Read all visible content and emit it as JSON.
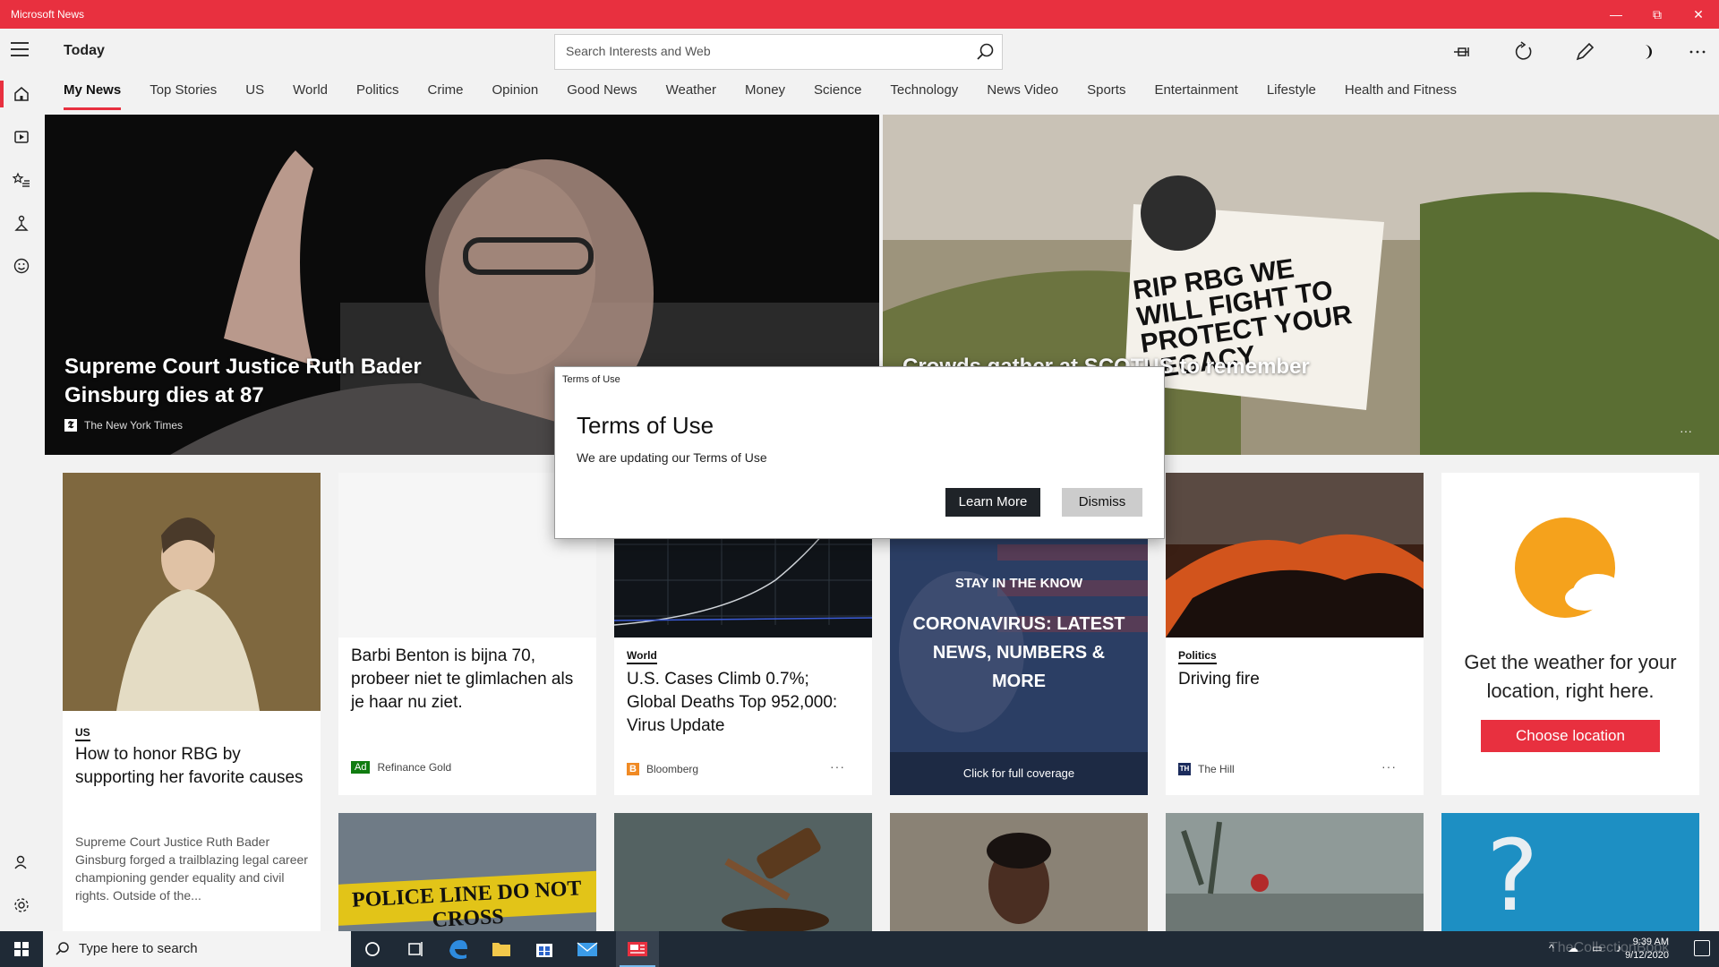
{
  "window": {
    "title": "Microsoft News"
  },
  "header": {
    "title": "Today",
    "search_placeholder": "Search Interests and Web"
  },
  "tabs": [
    {
      "label": "My News",
      "active": true
    },
    {
      "label": "Top Stories"
    },
    {
      "label": "US"
    },
    {
      "label": "World"
    },
    {
      "label": "Politics"
    },
    {
      "label": "Crime"
    },
    {
      "label": "Opinion"
    },
    {
      "label": "Good News"
    },
    {
      "label": "Weather"
    },
    {
      "label": "Money"
    },
    {
      "label": "Science"
    },
    {
      "label": "Technology"
    },
    {
      "label": "News Video"
    },
    {
      "label": "Sports"
    },
    {
      "label": "Entertainment"
    },
    {
      "label": "Lifestyle"
    },
    {
      "label": "Health and Fitness"
    }
  ],
  "hero": {
    "left": {
      "title": "Supreme Court Justice Ruth Bader Ginsburg dies at 87",
      "source": "The New York Times",
      "source_logo": "𝕿"
    },
    "right": {
      "title": "Crowds gather at SCOTUS to remember",
      "image_text": "RIP RBG WE WILL FIGHT TO PROTECT YOUR LEGACY"
    }
  },
  "cards": {
    "rbg": {
      "category": "US",
      "headline": "How to honor RBG by supporting her favorite causes",
      "abstract": "Supreme Court Justice Ruth Bader Ginsburg forged a trailblazing legal career championing gender equality and civil rights. Outside of the..."
    },
    "ad": {
      "headline": "Barbi Benton is bijna 70, probeer niet te glimlachen als je haar nu ziet.",
      "badge": "Ad",
      "source": "Refinance Gold"
    },
    "covid": {
      "category": "World",
      "headline": "U.S. Cases Climb 0.7%; Global Deaths Top 952,000: Virus Update",
      "source": "Bloomberg",
      "source_logo": "B",
      "more": "···"
    },
    "stay": {
      "kicker": "STAY IN THE KNOW",
      "headline": "CORONAVIRUS: LATEST NEWS, NUMBERS & MORE",
      "footer": "Click for full coverage"
    },
    "fire": {
      "category": "Politics",
      "headline": "Driving fire",
      "source": "The Hill",
      "source_logo": "TH",
      "more": "···"
    },
    "weather": {
      "text": "Get the weather for your location, right here.",
      "button": "Choose location"
    },
    "police": {
      "image_text": "POLICE LINE DO NOT CROSS"
    }
  },
  "dialog": {
    "window_title": "Terms of Use",
    "title": "Terms of Use",
    "body": "We are updating our Terms of Use",
    "primary": "Learn More",
    "secondary": "Dismiss"
  },
  "taskbar": {
    "search_placeholder": "Type here to search",
    "time": "9:39 AM",
    "date": "9/12/2020",
    "watermark": "TheCollectionBook"
  },
  "colors": {
    "accent": "#e8303f",
    "taskbar": "#1f2a36",
    "dialog_primary": "#1f2328"
  }
}
